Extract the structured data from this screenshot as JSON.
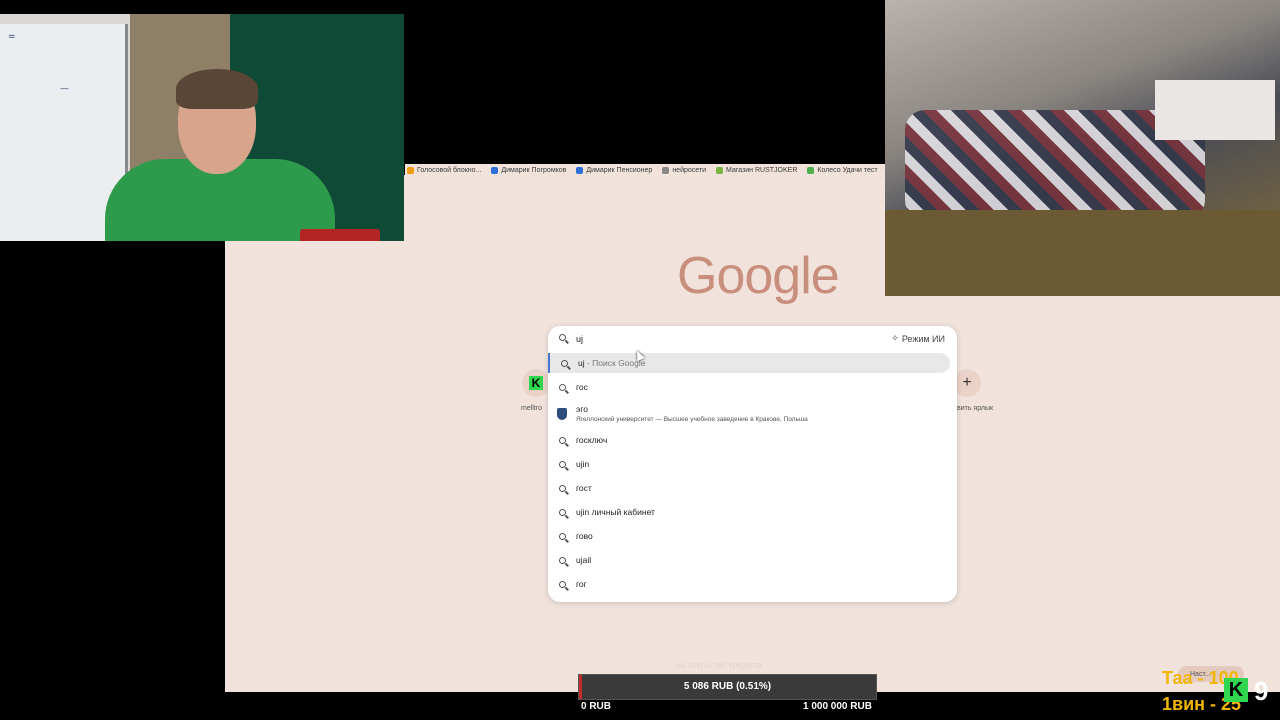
{
  "bookmarks": [
    {
      "label": "Голосовой блокно...",
      "color": "#f39c12"
    },
    {
      "label": "Димарик Погромков",
      "color": "#2e6fd9"
    },
    {
      "label": "Димарик Пенсионер",
      "color": "#2e6fd9"
    },
    {
      "label": "нейросети",
      "color": "#888888"
    },
    {
      "label": "Магазин RUSTJOKER",
      "color": "#7cb342"
    },
    {
      "label": "Колесо Удачи тест",
      "color": "#4caf50"
    }
  ],
  "google_logo": "Google",
  "search": {
    "query": "uj",
    "ai_mode": "Режим ИИ",
    "suggestions": [
      {
        "text": "uj",
        "hint": " - Поиск Google",
        "highlighted": true
      },
      {
        "text": "гос"
      },
      {
        "text": "эго",
        "sub": "Ягеллонский университет — Высшее учебное заведение в Кракове, Польша",
        "icon": "university-shield-icon"
      },
      {
        "text": "госключ"
      },
      {
        "text": "ujin"
      },
      {
        "text": "гост"
      },
      {
        "text": "ujin личный кабинет"
      },
      {
        "text": "гово"
      },
      {
        "text": "ujail"
      },
      {
        "text": "гог"
      }
    ]
  },
  "shortcuts": [
    {
      "label": "melltro",
      "icon": "K"
    },
    {
      "label": "вить ярлык",
      "icon": "+"
    }
  ],
  "footer_hint": "на закрытие кредита",
  "progress": {
    "value": "5 086 RUB (0.51%)",
    "fraction": 0.0051,
    "min": "0 RUB",
    "max": "1 000 000 RUB"
  },
  "overlay": {
    "line1": "Таа - 100",
    "line2": "1вин - 25",
    "badge": "K",
    "number": "9",
    "button": "Наст..."
  }
}
